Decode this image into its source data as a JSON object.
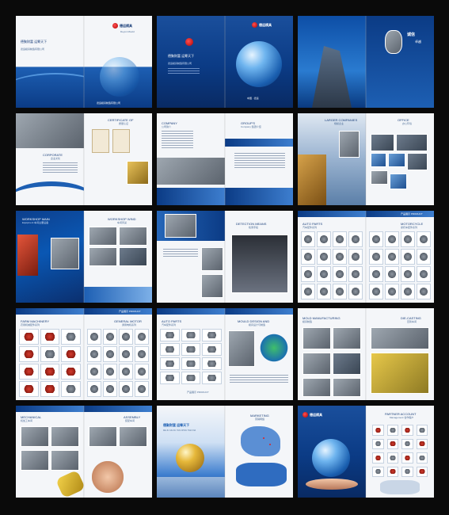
{
  "brand": {
    "name_cn": "德运模具",
    "name_en": "Deyun Mould",
    "slogan": "德聚财富 运筹天下",
    "company": "德运模具制造有限公司"
  },
  "spreads": [
    {
      "id": "cover-outside",
      "left": {
        "slogan": "德聚财富 运筹天下",
        "company": "德运模具制造有限公司"
      },
      "right": {
        "logo": "德运模具",
        "logo_en": "Deyun Mould",
        "company": "德运模具制造有限公司"
      }
    },
    {
      "id": "cover-inside",
      "left": {
        "logo": "德运模具",
        "slogan": "德聚财富 运筹天下",
        "company": "德运模具制造有限公司"
      },
      "right": {
        "logo": "德运模具",
        "caption": "中国 · 德运"
      }
    },
    {
      "id": "intro",
      "left": {},
      "right": {
        "heading": "诚信",
        "subheading": "卓越"
      }
    },
    {
      "id": "certificate",
      "left": {
        "heading": "CORPORATE",
        "subheading": "企业文化"
      },
      "right": {
        "heading": "CERTIFICATE OF",
        "subheading": "质量认证"
      }
    },
    {
      "id": "company",
      "left": {
        "heading": "COMPANY",
        "subheading": "公司简介"
      },
      "right": {
        "heading": "GROUP'S",
        "subheading": "Company 集团介绍"
      }
    },
    {
      "id": "larger",
      "left": {
        "heading": "LARGER COMPANIES",
        "subheading": "规模企业"
      },
      "right": {
        "heading": "OFFICE",
        "subheading": "办公环境"
      }
    },
    {
      "id": "workshop",
      "left": {
        "heading": "WORKSHOP MAIN",
        "subheading": "Equipment 车间主要设备"
      },
      "right": {
        "heading": "WORKSHOP WIND",
        "subheading": "车间风采"
      }
    },
    {
      "id": "detection",
      "left": {},
      "right": {
        "heading": "DETECTION MEANS",
        "subheading": "检测手段"
      }
    },
    {
      "id": "auto-moto",
      "left": {
        "heading": "AUTO PARTS",
        "subheading": "汽车配件系列"
      },
      "right": {
        "heading": "MOTORCYCLE",
        "subheading": "摩托车配件系列",
        "tag": "产品展示 PRODUCT"
      }
    },
    {
      "id": "farm-motor",
      "left": {
        "heading": "FARM MACHINERY",
        "subheading": "农用机械配件系列"
      },
      "right": {
        "heading": "GENERAL MOTOR",
        "subheading": "通用电机系列",
        "tag": "产品展示 PRODUCT"
      }
    },
    {
      "id": "auto-mould",
      "left": {
        "heading": "AUTO PARTS",
        "subheading": "汽车配件系列",
        "footer": "产品展示 PRODUCT"
      },
      "right": {
        "heading": "MOULD DESIGN AND",
        "subheading": "模具设计与制造"
      }
    },
    {
      "id": "mould-die",
      "left": {
        "heading": "MOLD MANUFACTURING",
        "subheading": "模具制造"
      },
      "right": {
        "heading": "DIE-CASTING",
        "subheading": "压铸车间"
      }
    },
    {
      "id": "mech-assembly",
      "left": {
        "heading": "MECHANICAL",
        "subheading": "机加工车间"
      },
      "right": {
        "heading": "ASSEMBLY",
        "subheading": "装配车间"
      }
    },
    {
      "id": "marketing",
      "left": {
        "slogan": "德聚财富 运筹天下",
        "caption": "DE JU CAI FU YUN CHOU TIAN XIA"
      },
      "right": {
        "heading": "MARKETING",
        "subheading": "营销网络"
      }
    },
    {
      "id": "partner",
      "left": {
        "logo": "德运模具"
      },
      "right": {
        "heading": "PARTNER ACCOUNT",
        "subheading": "Management 合作客户"
      }
    }
  ]
}
